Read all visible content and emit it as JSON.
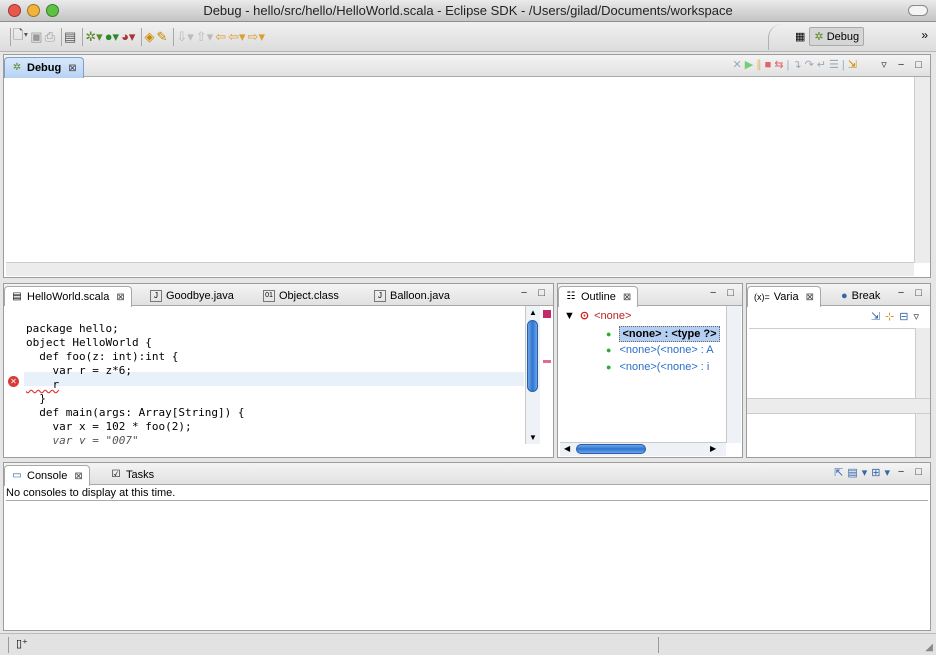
{
  "window": {
    "title": "Debug - hello/src/hello/HelloWorld.scala - Eclipse SDK - /Users/gilad/Documents/workspace"
  },
  "perspective": {
    "label": "Debug",
    "overflow": "»"
  },
  "debug_view": {
    "tab_label": "Debug"
  },
  "editor": {
    "tabs": [
      {
        "label": "HelloWorld.scala",
        "icon": "scala-file-icon"
      },
      {
        "label": "Goodbye.java",
        "icon": "java-file-icon"
      },
      {
        "label": "Object.class",
        "icon": "class-file-icon"
      },
      {
        "label": "Balloon.java",
        "icon": "java-file-icon"
      }
    ],
    "lines": [
      "package hello;",
      "",
      "object HelloWorld {",
      "  def foo(z: int):int {",
      "    var r = z*6;",
      "    r",
      "  }",
      "  def main(args: Array[String]) {",
      "    var x = 102 * foo(2);",
      "    var y = \"007\""
    ]
  },
  "outline": {
    "tab_label": "Outline",
    "root": "<none>",
    "items": [
      "<none> : <type ?>",
      "<none>(<none> : A",
      "<none>(<none> : i"
    ]
  },
  "variables": {
    "tab_label": "Varia",
    "tab2_label": "Break"
  },
  "console": {
    "tab_label": "Console",
    "tab2_label": "Tasks",
    "message": "No consoles to display at this time."
  }
}
